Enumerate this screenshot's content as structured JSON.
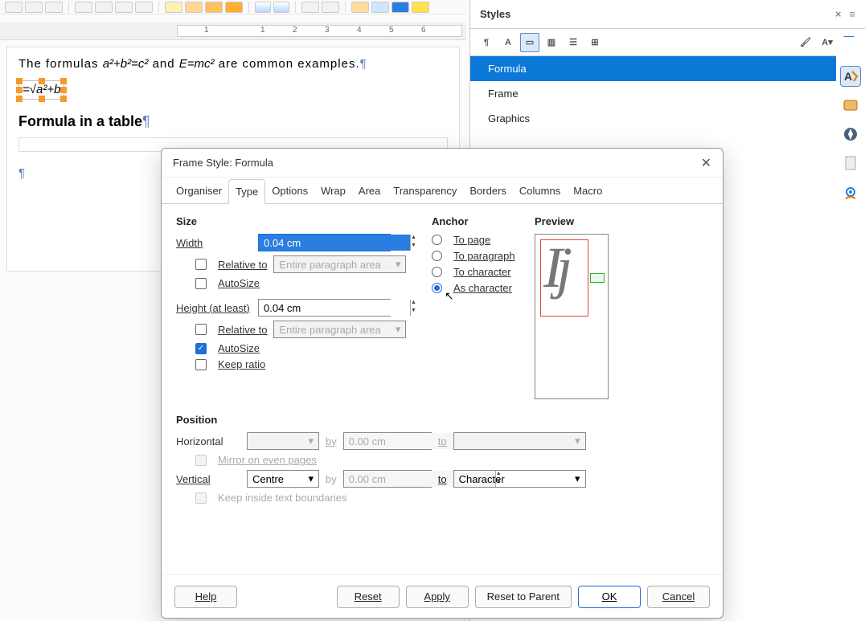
{
  "ruler": {
    "ticks": [
      "1",
      "1",
      "2",
      "3",
      "4",
      "5",
      "6"
    ]
  },
  "doc": {
    "line1_pre": "The formulas ",
    "line1_mid": " and ",
    "line1_post": " are common examples.",
    "formula1": "a²+b²=c²",
    "formula2": "E=mc²",
    "rootformula": "=√a²+b",
    "heading": "Formula in a table",
    "pilcrow": "¶"
  },
  "styles": {
    "title": "Styles",
    "list": [
      "Formula",
      "Frame",
      "Graphics"
    ],
    "selected": 0
  },
  "dialog": {
    "title": "Frame Style: Formula",
    "tabs": [
      "Organiser",
      "Type",
      "Options",
      "Wrap",
      "Area",
      "Transparency",
      "Borders",
      "Columns",
      "Macro"
    ],
    "active_tab": 1,
    "size": {
      "header": "Size",
      "width_label": "Width",
      "width_value": "0.04 cm",
      "relative_to": "Relative to",
      "relative_area": "Entire paragraph area",
      "autosize": "AutoSize",
      "height_label": "Height (at least)",
      "height_value": "0.04 cm",
      "keep_ratio": "Keep ratio",
      "autosize2_checked": true
    },
    "anchor": {
      "header": "Anchor",
      "opts": [
        "To page",
        "To paragraph",
        "To character",
        "As character"
      ],
      "selected": 3
    },
    "preview": {
      "header": "Preview"
    },
    "position": {
      "header": "Position",
      "horizontal": "Horizontal",
      "by": "by",
      "to": "to",
      "zero": "0.00 cm",
      "mirror": "Mirror on even pages",
      "vertical": "Vertical",
      "vert_value": "Centre",
      "vert_to": "Character",
      "keep_inside": "Keep inside text boundaries"
    },
    "buttons": {
      "help": "Help",
      "reset": "Reset",
      "apply": "Apply",
      "reset_parent": "Reset to Parent",
      "ok": "OK",
      "cancel": "Cancel"
    }
  }
}
